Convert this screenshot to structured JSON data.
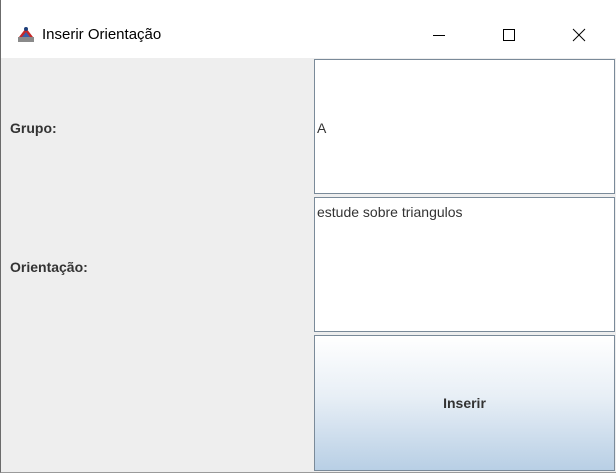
{
  "window": {
    "title": "Inserir Orientação",
    "controls": {
      "minimize": "minimize-icon",
      "maximize": "maximize-icon",
      "close": "close-icon"
    }
  },
  "form": {
    "grupo_label": "Grupo:",
    "grupo_value": "A",
    "orientacao_label": "Orientação:",
    "orientacao_value": "estude sobre triangulos",
    "submit_label": "Inserir"
  },
  "colors": {
    "panel_background": "#eeeeee",
    "button_gradient_top": "#ffffff",
    "button_gradient_bottom": "#b8cfe5",
    "border": "#7a8a99"
  }
}
